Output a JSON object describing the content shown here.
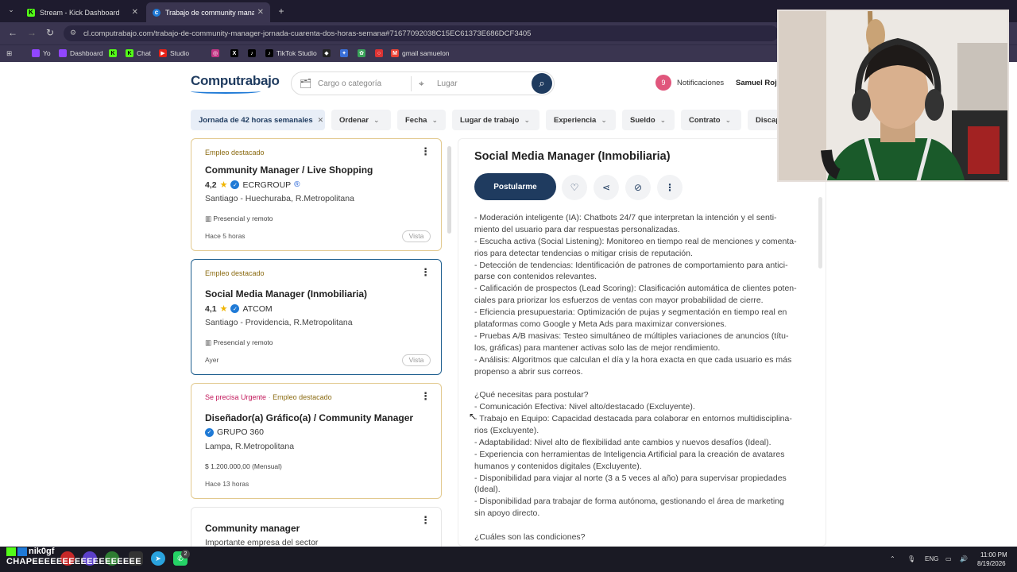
{
  "browser": {
    "tabs": [
      {
        "title": "Stream - Kick Dashboard",
        "active": false
      },
      {
        "title": "Trabajo de community manager",
        "active": true
      }
    ],
    "url": "cl.computrabajo.com/trabajo-de-community-manager-jornada-cuarenta-dos-horas-semana#71677092038C15EC61373E686DCF3405",
    "bookmarks": [
      "Yo",
      "Dashboard",
      "",
      "Chat",
      "Studio",
      "",
      "",
      "TikTok Studio",
      "",
      "",
      "",
      "",
      "gmail samuelon"
    ]
  },
  "site": {
    "logo": "Computrabajo",
    "search_placeholder": "Cargo o categoría",
    "location_placeholder": "Lugar",
    "notifications_count": "9",
    "notifications_label": "Notificaciones",
    "user_name": "Samuel Roja"
  },
  "filters": [
    {
      "label": "Jornada de 42 horas semanales",
      "active": true
    },
    {
      "label": "Ordenar"
    },
    {
      "label": "Fecha"
    },
    {
      "label": "Lugar de trabajo"
    },
    {
      "label": "Experiencia"
    },
    {
      "label": "Sueldo"
    },
    {
      "label": "Contrato"
    },
    {
      "label": "Discapa"
    }
  ],
  "jobs": [
    {
      "tag": "Empleo destacado",
      "title": "Community Manager / Live Shopping",
      "rating": "4,2",
      "company": "ECRGROUP",
      "location": "Santiago - Huechuraba, R.Metropolitana",
      "modality": "Presencial y remoto",
      "time": "Hace 5 horas",
      "seen": "Vista"
    },
    {
      "tag": "Empleo destacado",
      "title": "Social Media Manager (Inmobiliaria)",
      "rating": "4,1",
      "company": "ATCOM",
      "location": "Santiago - Providencia, R.Metropolitana",
      "modality": "Presencial y remoto",
      "time": "Ayer",
      "seen": "Vista"
    },
    {
      "urgent": "Se precisa Urgente",
      "tag": "Empleo destacado",
      "title": "Diseñador(a) Gráfico(a) / Community Manager",
      "company": "GRUPO 360",
      "location": "Lampa, R.Metropolitana",
      "salary": "$ 1.200.000,00 (Mensual)",
      "time": "Hace 13 horas"
    },
    {
      "title": "Community manager",
      "company": "Importante empresa del sector"
    }
  ],
  "detail": {
    "title": "Social Media Manager (Inmobiliaria)",
    "apply_label": "Postularme",
    "lines": [
      "- Moderación inteligente (IA): Chatbots 24/7 que interpretan la intención y el senti-",
      "miento del usuario para dar respuestas personalizadas.",
      "- Escucha activa (Social Listening): Monitoreo en tiempo real de menciones y comenta-",
      "rios para detectar tendencias o mitigar crisis de reputación.",
      "- Detección de tendencias: Identificación de patrones de comportamiento para antici-",
      "parse con contenidos relevantes.",
      "- Calificación de prospectos (Lead Scoring): Clasificación automática de clientes poten-",
      "ciales para priorizar los esfuerzos de ventas con mayor probabilidad de cierre.",
      "- Eficiencia presupuestaria: Optimización de pujas y segmentación en tiempo real en",
      "plataformas como Google y Meta Ads para maximizar conversiones.",
      "- Pruebas A/B masivas: Testeo simultáneo de múltiples variaciones de anuncios (títu-",
      "los, gráficas) para mantener activas solo las de mejor rendimiento.",
      "- Análisis: Algoritmos que calculan el día y la hora exacta en que cada usuario es más",
      "propenso a abrir sus correos.",
      "",
      "¿Qué necesitas para postular?",
      "- Comunicación Efectiva: Nivel alto/destacado (Excluyente).",
      "- Trabajo en Equipo: Capacidad destacada para colaborar en entornos multidisciplina-",
      "rios (Excluyente).",
      "- Adaptabilidad: Nivel alto de flexibilidad ante cambios y nuevos desafíos (Ideal).",
      "- Experiencia con herramientas de Inteligencia Artificial para la creación de avatares",
      "humanos y contenidos digitales (Excluyente).",
      "- Disponibilidad para viajar al norte (3 a 5 veces al año) para supervisar propiedades",
      "(Ideal).",
      "- Disponibilidad para trabajar de forma autónoma, gestionando el área de marketing",
      "sin apoyo directo.",
      "",
      "¿Cuáles son las condiciones?"
    ]
  },
  "overlay": {
    "chat_user": "nik0gf",
    "chat_message": "CHAPEEEEEEEEEEEEEEEEEE"
  },
  "taskbar": {
    "whatsapp_badge": "2",
    "lang": "ENG",
    "time": "11:00 PM",
    "date": "8/19/2026"
  },
  "colors": {
    "brand_navy": "#1f3b5f",
    "featured_border": "#e2c98f",
    "urgent": "#c2185b",
    "notification": "#e0567c"
  }
}
